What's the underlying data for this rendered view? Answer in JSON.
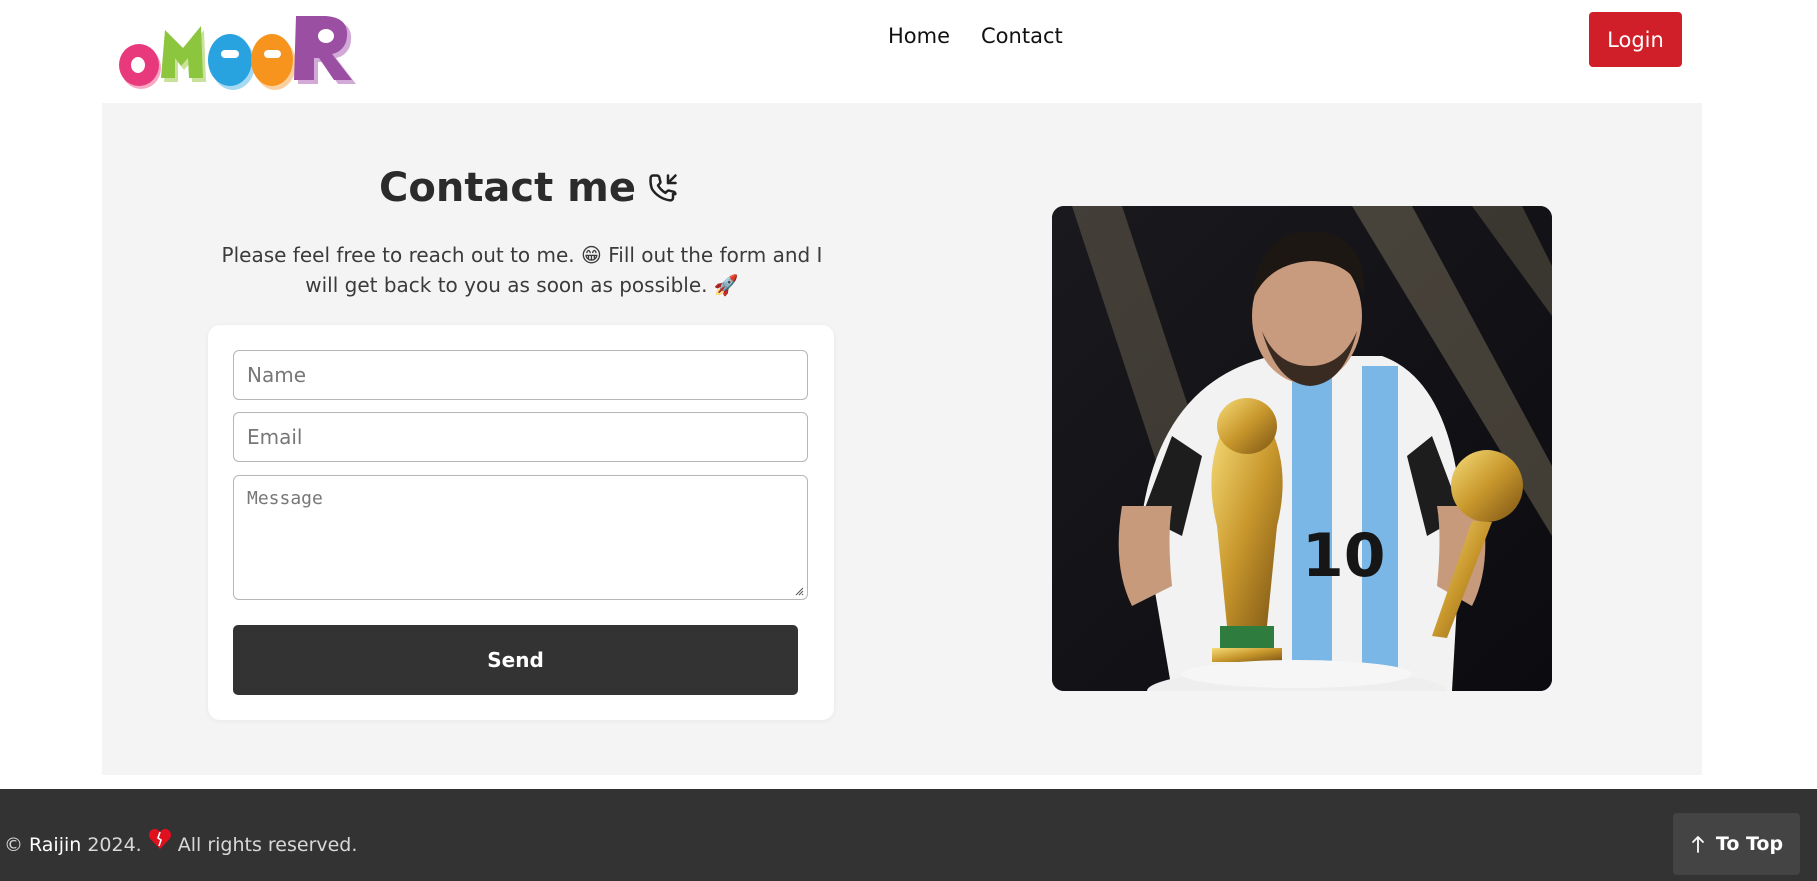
{
  "header": {
    "logo_text": "ameeR",
    "logo_colors": [
      "#e8397c",
      "#8cc63f",
      "#29a3e0",
      "#f7941d",
      "#9b4fa3"
    ],
    "nav": [
      {
        "label": "Home"
      },
      {
        "label": "Contact"
      }
    ],
    "login_label": "Login"
  },
  "contact": {
    "title": "Contact me",
    "description": "Please feel free to reach out to me. 😁 Fill out the form and I will get back to you as soon as possible. 🚀",
    "form": {
      "name_placeholder": "Name",
      "email_placeholder": "Email",
      "message_placeholder": "Message",
      "send_label": "Send"
    }
  },
  "footer": {
    "copyright_symbol": "©",
    "brand": "Raijin",
    "year_text": "2024.",
    "rights_text": "All rights reserved.",
    "to_top_label": "To Top"
  },
  "colors": {
    "accent": "#d11f2a",
    "dark": "#333333",
    "heart": "#e0101e"
  }
}
